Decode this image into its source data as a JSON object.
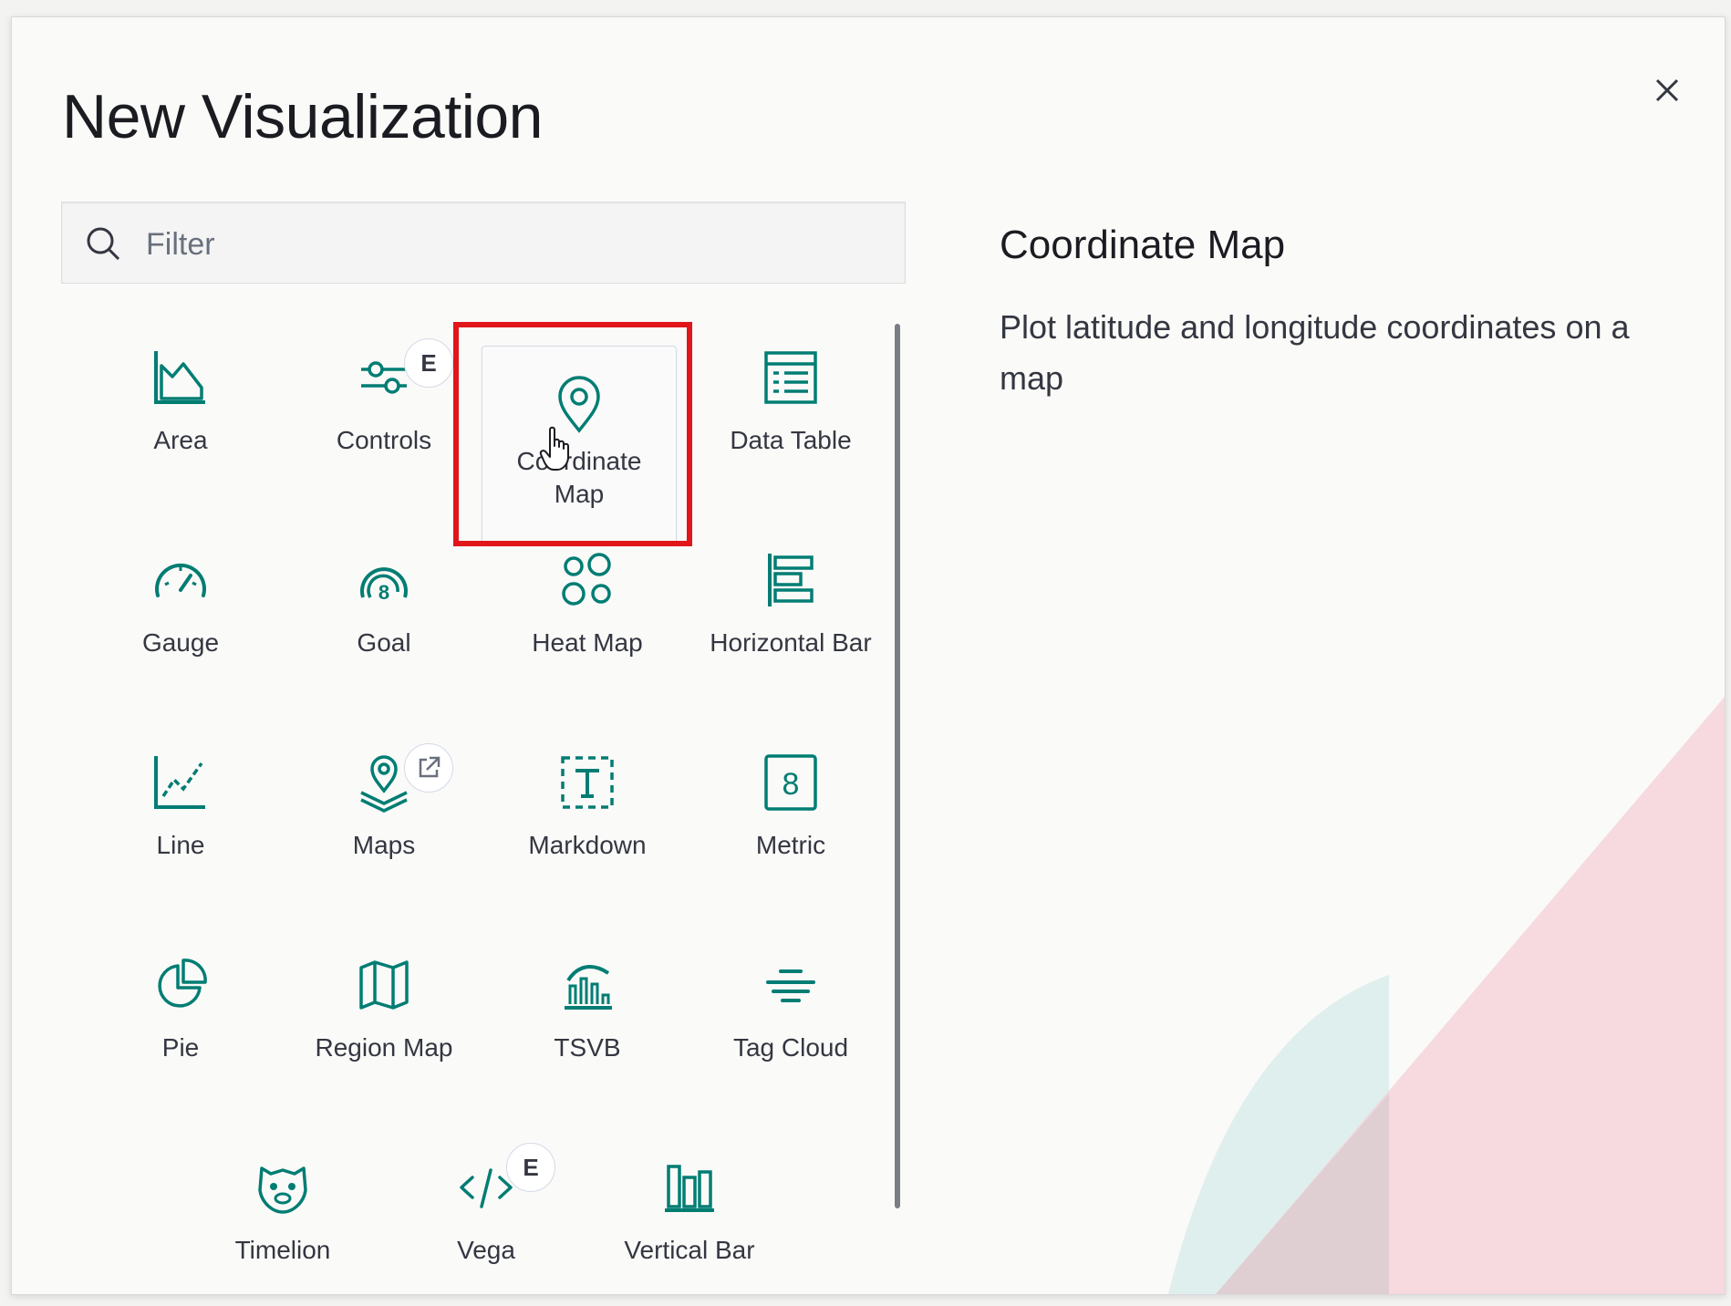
{
  "modal": {
    "title": "New Visualization",
    "close_label": "×"
  },
  "search": {
    "placeholder": "Filter",
    "value": ""
  },
  "colors": {
    "icon": "#017d73",
    "highlight": "#e0161b"
  },
  "visualizations": [
    {
      "label": "Area",
      "icon": "area-chart-icon"
    },
    {
      "label": "Controls",
      "icon": "controls-icon",
      "badge": "E"
    },
    {
      "label": "Coordinate Map",
      "icon": "map-pin-icon",
      "selected": true
    },
    {
      "label": "Data Table",
      "icon": "table-icon"
    },
    {
      "label": "Gauge",
      "icon": "gauge-icon"
    },
    {
      "label": "Goal",
      "icon": "goal-icon"
    },
    {
      "label": "Heat Map",
      "icon": "heatmap-icon"
    },
    {
      "label": "Horizontal Bar",
      "icon": "horizontal-bar-icon"
    },
    {
      "label": "Line",
      "icon": "line-chart-icon"
    },
    {
      "label": "Maps",
      "icon": "maps-icon",
      "badge_icon": "external-link-icon"
    },
    {
      "label": "Markdown",
      "icon": "markdown-icon"
    },
    {
      "label": "Metric",
      "icon": "metric-icon"
    },
    {
      "label": "Pie",
      "icon": "pie-chart-icon"
    },
    {
      "label": "Region Map",
      "icon": "region-map-icon"
    },
    {
      "label": "TSVB",
      "icon": "tsvb-icon"
    },
    {
      "label": "Tag Cloud",
      "icon": "tag-cloud-icon"
    },
    {
      "label": "Timelion",
      "icon": "timelion-icon"
    },
    {
      "label": "Vega",
      "icon": "code-icon",
      "badge": "E"
    },
    {
      "label": "Vertical Bar",
      "icon": "vertical-bar-icon"
    }
  ],
  "description": {
    "title": "Coordinate Map",
    "text": "Plot latitude and longitude coordinates on a map"
  }
}
